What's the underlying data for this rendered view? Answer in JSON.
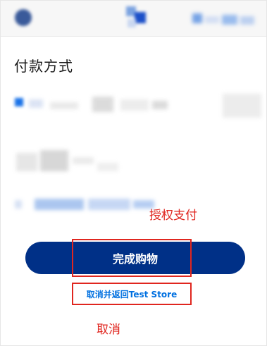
{
  "page": {
    "title": "付款方式"
  },
  "annotations": {
    "authorize_label": "授权支付",
    "cancel_label": "取消"
  },
  "actions": {
    "complete_purchase": "完成购物",
    "cancel_and_return": "取消并返回Test Store"
  },
  "colors": {
    "primary_button": "#003087",
    "link": "#0070e0",
    "annotation": "#e0261f"
  }
}
